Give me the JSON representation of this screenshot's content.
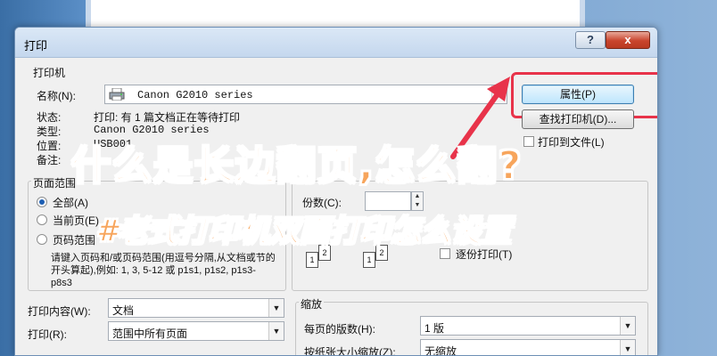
{
  "dialog": {
    "title": "打印",
    "help_label": "?",
    "close_label": "x"
  },
  "printer": {
    "group_label": "打印机",
    "name_label": "名称(N):",
    "name_value": "Canon G2010 series",
    "properties_button": "属性(P)",
    "find_printer_button": "查找打印机(D)...",
    "print_to_file_label": "打印到文件(L)",
    "status_label": "状态:",
    "status_value": "打印: 有 1 篇文档正在等待打印",
    "type_label": "类型:",
    "type_value": "Canon G2010 series",
    "location_label": "位置:",
    "location_value": "USB001",
    "comment_label": "备注:"
  },
  "page_range": {
    "group_label": "页面范围",
    "all_label": "全部(A)",
    "current_label": "当前页(E)",
    "pages_label": "页码范围",
    "hint_text": "请键入页码和/或页码范围(用逗号分隔,从文档或节的开头算起),例如: 1, 3, 5-12 或 p1s1, p1s2, p1s3-p8s3"
  },
  "copies": {
    "label": "份数(C):",
    "collate_label": "逐份打印(T)",
    "page_icons": [
      "1",
      "2",
      "1",
      "2"
    ]
  },
  "print_what": {
    "label": "打印内容(W):",
    "value": "文档"
  },
  "print_range": {
    "label": "打印(R):",
    "value": "范围中所有页面"
  },
  "zoom": {
    "group_label": "缩放",
    "pages_per_sheet_label": "每页的版数(H):",
    "pages_per_sheet_value": "1 版",
    "scale_label": "按纸张大小缩放(Z):",
    "scale_value": "无缩放"
  },
  "overlay": {
    "headline": "什么是长边翻页,怎么翻?",
    "subheadline": "#老式打印机双面打印怎么设置"
  },
  "colors": {
    "highlight": "#e8334a",
    "overlay_text": "#f7a55c",
    "close_button": "#c9442c"
  }
}
